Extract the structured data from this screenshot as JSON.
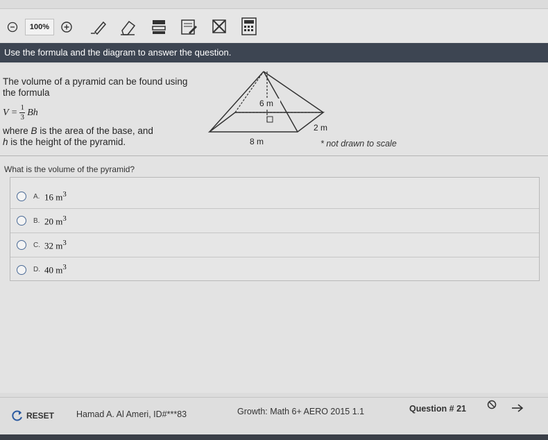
{
  "toolbar": {
    "zoom_value": "100%",
    "icons": [
      "zoom-out-icon",
      "zoom-in-icon",
      "pencil-icon",
      "eraser-icon",
      "highlighter-icon",
      "notepad-icon",
      "strikethrough-icon",
      "calculator-icon"
    ]
  },
  "banner": {
    "instruction": "Use the formula and the diagram to answer the question."
  },
  "passage": {
    "line1": "The volume of a pyramid can be found using the formula",
    "formula_lhs": "V =",
    "formula_num": "1",
    "formula_den": "3",
    "formula_rhs": "Bh",
    "line2a": "where",
    "var_B": "B",
    "line2b": "is the area of the base, and",
    "var_h": "h",
    "line2c": "is the height of the pyramid."
  },
  "diagram": {
    "height_label": "6 m",
    "width_label": "2 m",
    "length_label": "8 m",
    "note": "not drawn to scale"
  },
  "question": {
    "text": "What is the volume of the pyramid?"
  },
  "choices": [
    {
      "letter": "A.",
      "value": "16 m",
      "sup": "3"
    },
    {
      "letter": "B.",
      "value": "20 m",
      "sup": "3"
    },
    {
      "letter": "C.",
      "value": "32 m",
      "sup": "3"
    },
    {
      "letter": "D.",
      "value": "40 m",
      "sup": "3"
    }
  ],
  "footer": {
    "reset_label": "RESET",
    "student": "Hamad A. Al Ameri, ID#***83",
    "test": "Growth: Math 6+ AERO 2015 1.1",
    "question_number": "Question # 21"
  }
}
